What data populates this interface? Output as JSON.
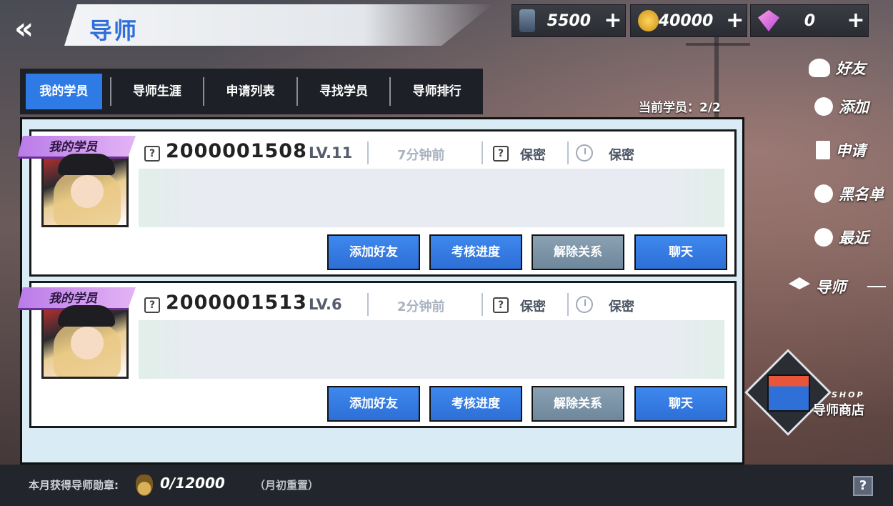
{
  "header": {
    "title": "导师",
    "back_icon": "«"
  },
  "resources": [
    {
      "icon": "oil-barrel-icon",
      "value": "5500",
      "plus": "+"
    },
    {
      "icon": "gold-coin-icon",
      "value": "40000",
      "plus": "+"
    },
    {
      "icon": "gem-icon",
      "value": "0",
      "plus": "+"
    }
  ],
  "tabs": [
    "我的学员",
    "导师生涯",
    "申请列表",
    "寻找学员",
    "导师排行"
  ],
  "counter": "当前学员：2/2",
  "students": [
    {
      "badge": "我的学员",
      "uid": "2000001508",
      "level": "LV.11",
      "last_seen": "7分钟前",
      "privacy1": "保密",
      "privacy2": "保密",
      "buttons": [
        "添加好友",
        "考核进度",
        "解除关系",
        "聊天"
      ]
    },
    {
      "badge": "我的学员",
      "uid": "2000001513",
      "level": "LV.6",
      "last_seen": "2分钟前",
      "privacy1": "保密",
      "privacy2": "保密",
      "buttons": [
        "添加好友",
        "考核进度",
        "解除关系",
        "聊天"
      ]
    }
  ],
  "right_menu": {
    "friends": "好友",
    "add": "添加",
    "apply": "申请",
    "blacklist": "黑名单",
    "recent": "最近",
    "mentor": "导师"
  },
  "shop": {
    "tag": "SHOP",
    "label": "导师商店"
  },
  "footer": {
    "medal_label": "本月获得导师勋章:",
    "medal_progress": "0/12000",
    "reset_note": "（月初重置）",
    "help": "?"
  },
  "colors": {
    "accent": "#2f7be6",
    "grey_button": "#7f95a8",
    "badge": "#c98ef0"
  }
}
